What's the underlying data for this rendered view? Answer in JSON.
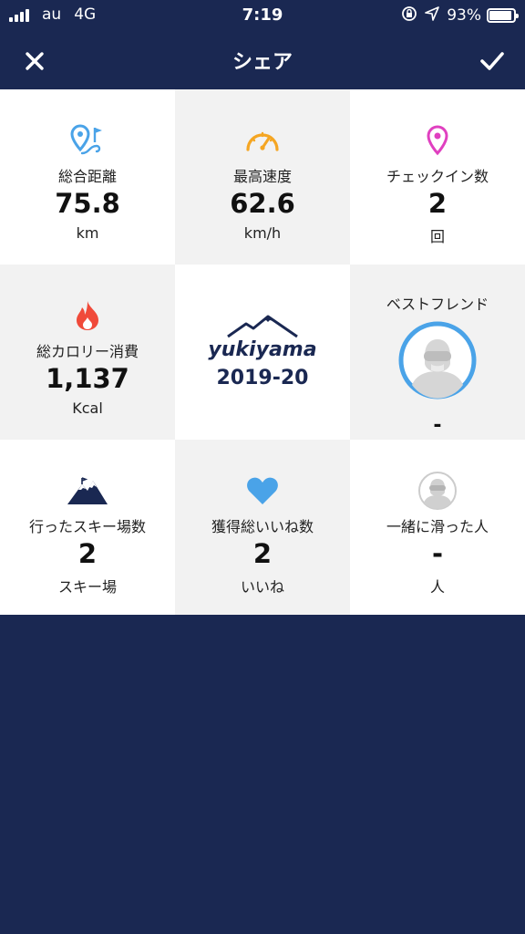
{
  "status": {
    "carrier": "au",
    "network": "4G",
    "time": "7:19",
    "battery_percent": "93%",
    "battery_level": 0.93
  },
  "nav": {
    "title": "シェア",
    "close_icon": "close-icon",
    "confirm_icon": "checkmark-icon"
  },
  "stats": {
    "distance": {
      "label": "総合距離",
      "value": "75.8",
      "unit": "km",
      "icon": "map-pin-route-icon"
    },
    "max_speed": {
      "label": "最高速度",
      "value": "62.6",
      "unit": "km/h",
      "icon": "speedometer-icon"
    },
    "checkins": {
      "label": "チェックイン数",
      "value": "2",
      "unit": "回",
      "icon": "location-pin-icon"
    },
    "calories": {
      "label": "総カロリー消費",
      "value": "1,137",
      "unit": "Kcal",
      "icon": "flame-icon"
    },
    "best_friend": {
      "label": "ベストフレンド",
      "value": "-",
      "icon": "avatar-icon"
    },
    "resorts": {
      "label": "行ったスキー場数",
      "value": "2",
      "unit": "スキー場",
      "icon": "mountain-icon"
    },
    "likes": {
      "label": "獲得総いいね数",
      "value": "2",
      "unit": "いいね",
      "icon": "heart-icon"
    },
    "together": {
      "label": "一緒に滑った人",
      "value": "-",
      "unit": "人",
      "icon": "avatar-icon"
    }
  },
  "brand": {
    "logo": "yukiyama",
    "season": "2019-20"
  },
  "colors": {
    "navy": "#1a2852",
    "blue": "#4aa3e8",
    "orange": "#f5a623",
    "pink": "#e040c0",
    "red": "#f04a3a"
  }
}
